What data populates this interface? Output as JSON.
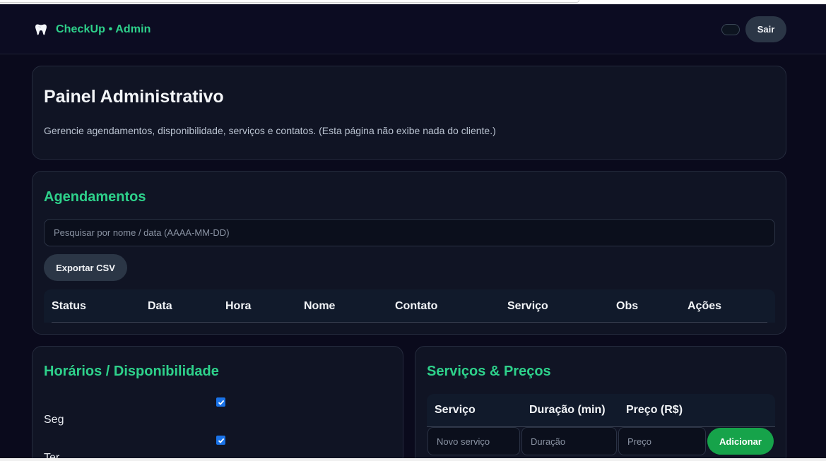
{
  "header": {
    "brand": "CheckUp • Admin",
    "logout_label": "Sair"
  },
  "intro": {
    "title": "Painel Administrativo",
    "description": "Gerencie agendamentos, disponibilidade, serviços e contatos. (Esta página não exibe nada do cliente.)"
  },
  "appointments": {
    "title": "Agendamentos",
    "search_placeholder": "Pesquisar por nome / data (AAAA-MM-DD)",
    "search_value": "",
    "export_label": "Exportar CSV",
    "columns": [
      "Status",
      "Data",
      "Hora",
      "Nome",
      "Contato",
      "Serviço",
      "Obs",
      "Ações"
    ],
    "rows": []
  },
  "availability": {
    "title": "Horários / Disponibilidade",
    "days": [
      {
        "label": "Seg",
        "checked": true
      },
      {
        "label": "Ter",
        "checked": true
      }
    ]
  },
  "services": {
    "title": "Serviços & Preços",
    "columns": [
      "Serviço",
      "Duração (min)",
      "Preço (R$)"
    ],
    "new_service_placeholder": "Novo serviço",
    "duration_placeholder": "Duração",
    "price_placeholder": "Preço",
    "add_label": "Adicionar"
  },
  "colors": {
    "accent": "#2ed18b",
    "add_button": "#16a34a",
    "background": "#0a0a1c",
    "card": "#101424"
  },
  "icons": {
    "brand": "tooth-icon",
    "theme_toggle": "toggle-switch",
    "checkbox": "checkmark-icon"
  }
}
